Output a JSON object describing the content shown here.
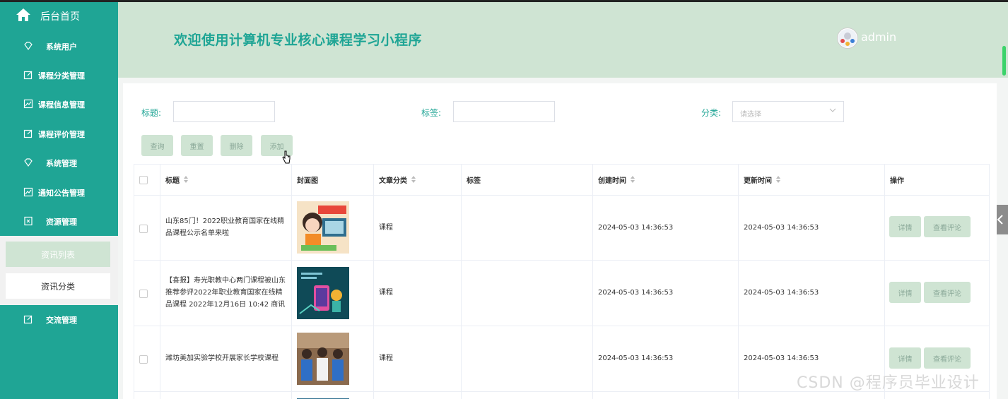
{
  "sidebar": {
    "home": "后台首页",
    "items": [
      {
        "label": "系统用户",
        "icon": "diamond-icon"
      },
      {
        "label": "课程分类管理",
        "icon": "edit-icon"
      },
      {
        "label": "课程信息管理",
        "icon": "chart-icon"
      },
      {
        "label": "课程评价管理",
        "icon": "edit-icon"
      },
      {
        "label": "系统管理",
        "icon": "diamond-icon"
      },
      {
        "label": "通知公告管理",
        "icon": "chart-icon"
      },
      {
        "label": "资源管理",
        "icon": "file-icon"
      }
    ],
    "submenu": {
      "active": "资讯列表",
      "item": "资讯分类"
    },
    "last": {
      "label": "交流管理",
      "icon": "edit-icon"
    }
  },
  "header": {
    "title": "欢迎使用计算机专业核心课程学习小程序",
    "username": "admin"
  },
  "filters": {
    "title_label": "标题:",
    "tag_label": "标签:",
    "category_label": "分类:",
    "category_placeholder": "请选择"
  },
  "buttons": {
    "query": "查询",
    "reset": "重置",
    "delete": "删除",
    "add": "添加"
  },
  "table": {
    "headers": {
      "title": "标题",
      "cover": "封面图",
      "category": "文章分类",
      "tags": "标签",
      "created": "创建时间",
      "updated": "更新时间",
      "actions": "操作"
    },
    "rows": [
      {
        "title": "山东85门！2022职业教育国家在线精品课程公示名单来啦",
        "category": "课程",
        "tags": "",
        "created": "2024-05-03 14:36:53",
        "updated": "2024-05-03 14:36:53",
        "detail": "详情",
        "comments": "查看评论"
      },
      {
        "title": "【喜报】寿光职教中心两门课程被山东推荐参评2022年职业教育国家在线精品课程 2022年12月16日 10:42 商讯",
        "category": "课程",
        "tags": "",
        "created": "2024-05-03 14:36:53",
        "updated": "2024-05-03 14:36:53",
        "detail": "详情",
        "comments": "查看评论"
      },
      {
        "title": "潍坊美加实验学校开展家长学校课程",
        "category": "课程",
        "tags": "",
        "created": "2024-05-03 14:36:53",
        "updated": "2024-05-03 14:36:53",
        "detail": "详情",
        "comments": "查看评论"
      }
    ]
  },
  "watermark": "CSDN @程序员毕业设计",
  "colors": {
    "primary": "#1fa595",
    "header_bg": "#cfe4d3",
    "button_bg": "#cfe4d3"
  }
}
